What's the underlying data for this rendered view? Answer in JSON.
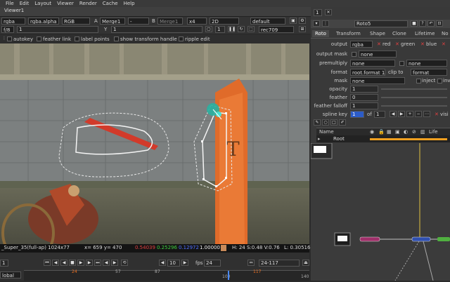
{
  "menu": [
    "File",
    "Edit",
    "Layout",
    "Viewer",
    "Render",
    "Cache",
    "Help"
  ],
  "viewer_tab": "Viewer1",
  "viewer_controls": {
    "channels": "rgba",
    "alpha_channel": "rgba.alpha",
    "display": "RGB",
    "input_a_label": "A",
    "input_a": "Merge1",
    "dash": "-",
    "input_b_label": "B",
    "input_b": "Merge1",
    "zoom": "x4",
    "view_mode": "2D",
    "lut": "default",
    "fstop": "f/8",
    "gain": "1",
    "y_label": "Y",
    "gamma": "1",
    "proxy": "1",
    "colorspace": "rec709"
  },
  "roto_toolbar": {
    "autokey": "autokey",
    "feather_link": "feather link",
    "label_points": "label points",
    "show_transform_handle": "show transform handle",
    "ripple_edit": "ripple edit"
  },
  "viewport": {
    "banner_glyph": "T"
  },
  "info_bar": {
    "format": "_Super_35(full-ap) 1024x77",
    "xy": "x= 659 y= 470",
    "r": "0.54039",
    "g": "0.25296",
    "b": "0.12972",
    "a": "1.00000",
    "hsv": "H: 24 S:0.48 V:0.76",
    "l": "L: 0.30516",
    "swatch_color": "#c88a5a"
  },
  "timeline": {
    "frame": "1",
    "fps_label": "fps",
    "fps": "24",
    "step": "10",
    "range": "24-117",
    "marks": [
      "24",
      "57",
      "87",
      "100",
      "117",
      "140"
    ],
    "global": "lobal"
  },
  "properties": {
    "panel_count": "1",
    "node_name": "Roto5",
    "tabs": [
      "Roto",
      "Transform",
      "Shape",
      "Clone",
      "Lifetime",
      "No"
    ],
    "output_label": "output",
    "output": "rgba",
    "red": "red",
    "green": "green",
    "blue": "blue",
    "output_mask_label": "output mask",
    "output_mask": "none",
    "premultiply_label": "premultiply",
    "premultiply": "none",
    "premultiply2": "none",
    "format_label": "format",
    "format": "root.format 1",
    "clip_to": "clip to",
    "clip_format": "format",
    "mask_label": "mask",
    "mask": "none",
    "inject": "inject",
    "invert": "inv",
    "opacity_label": "opacity",
    "opacity": "1",
    "feather_label": "feather",
    "feather": "0",
    "feather_falloff_label": "feather falloff",
    "feather_falloff": "1",
    "spline_key_label": "spline key",
    "spline_key": "1",
    "of": "of",
    "spline_total": "1",
    "visible": "visi",
    "columns": {
      "name": "Name",
      "life": "Life"
    },
    "root": "Root"
  },
  "colors": {
    "accent": "#f0a020",
    "roto_node": "#a0306a",
    "merge_node": "#3050b0",
    "green_node": "#50b040"
  }
}
